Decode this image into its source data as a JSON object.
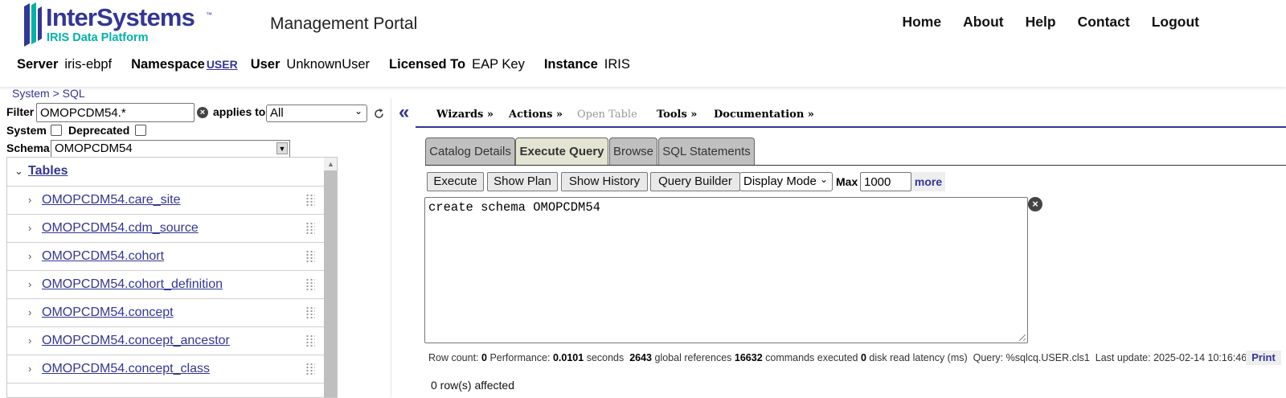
{
  "header": {
    "logo_text": "InterSystems",
    "logo_tm": "™",
    "logo_subtitle": "IRIS Data Platform",
    "portal_title": "Management Portal",
    "nav": [
      "Home",
      "About",
      "Help",
      "Contact",
      "Logout"
    ]
  },
  "info": {
    "server_label": "Server",
    "server": "iris-ebpf",
    "namespace_label": "Namespace",
    "namespace": "USER",
    "user_label": "User",
    "user": "UnknownUser",
    "licensed_label": "Licensed To",
    "licensed": "EAP Key",
    "instance_label": "Instance",
    "instance": "IRIS"
  },
  "breadcrumb": {
    "items": [
      "System",
      "SQL"
    ],
    "separator": ">"
  },
  "filter": {
    "label": "Filter",
    "value": "OMOPCDM54.*",
    "applies_label": "applies to",
    "applies_value": "All",
    "system_label": "System",
    "deprecated_label": "Deprecated",
    "schema_label": "Schema",
    "schema_value": "OMOPCDM54"
  },
  "tree": {
    "root": "Tables",
    "items": [
      "OMOPCDM54.care_site",
      "OMOPCDM54.cdm_source",
      "OMOPCDM54.cohort",
      "OMOPCDM54.cohort_definition",
      "OMOPCDM54.concept",
      "OMOPCDM54.concept_ancestor",
      "OMOPCDM54.concept_class"
    ]
  },
  "menu": {
    "collapse": "«",
    "wizards": "Wizards »",
    "actions": "Actions »",
    "open_table": "Open Table",
    "tools": "Tools »",
    "documentation": "Documentation »"
  },
  "tabs": [
    "Catalog Details",
    "Execute Query",
    "Browse",
    "SQL Statements"
  ],
  "toolbar": {
    "execute": "Execute",
    "show_plan": "Show Plan",
    "show_history": "Show History",
    "query_builder": "Query Builder",
    "display_mode": "Display Mode",
    "max_label": "Max",
    "max_value": "1000",
    "more": "more"
  },
  "query": {
    "text": "create schema OMOPCDM54"
  },
  "stats": {
    "row_count_label": "Row count:",
    "row_count": "0",
    "performance_label": "Performance:",
    "performance": "0.0101",
    "seconds": "seconds",
    "global_refs": "2643",
    "global_refs_label": "global references",
    "commands": "16632",
    "commands_label": "commands executed",
    "disk": "0",
    "disk_label": "disk read latency (ms)",
    "query_label": "Query:",
    "query_name": "%sqlcq.USER.cls1",
    "update_label": "Last update:",
    "update": "2025-02-14 10:16:46.370",
    "print": "Print"
  },
  "result": {
    "affected": "0 row(s) affected"
  },
  "colors": {
    "brand": "#333695",
    "accent": "#00b2a9",
    "active_tab": "#e4e4d2",
    "inactive_tab": "#c0c0c0"
  },
  "icons": [
    "intersystems-logo-icon",
    "clear-icon",
    "refresh-icon",
    "chevron-down-icon",
    "chevron-right-icon",
    "drag-grip-icon"
  ]
}
